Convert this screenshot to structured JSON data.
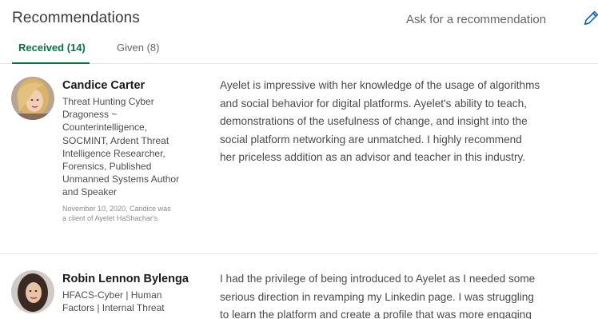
{
  "header": {
    "title": "Recommendations",
    "ask_link": "Ask for a recommendation",
    "edit_icon": "pencil-icon"
  },
  "tabs": [
    {
      "label": "Received (14)",
      "active": true
    },
    {
      "label": "Given (8)",
      "active": false
    }
  ],
  "recommendations": [
    {
      "name": "Candice Carter",
      "headline_lines": [
        "Threat Hunting Cyber",
        "Dragoness ~",
        "Counterintelligence,",
        "SOCMINT, Ardent Threat",
        "Intelligence Researcher,",
        "Forensics, Published",
        "Unmanned Systems Author",
        "and Speaker"
      ],
      "meta_lines": [
        "November 10, 2020, Candice was",
        "a client of Ayelet HaShachar's"
      ],
      "text_lines": [
        "Ayelet is impressive with her knowledge of the usage of algorithms",
        "and social behavior for digital platforms. Ayelet's ability to teach,",
        "demonstrations of the usefulness of change, and insight into the",
        "social platform networking are unmatched. I highly recommend",
        "her priceless addition as an advisor and teacher in this industry."
      ]
    },
    {
      "name": "Robin Lennon Bylenga",
      "headline_lines": [
        "HFACS-Cyber | Human",
        "Factors | Internal Threat"
      ],
      "text_lines": [
        "I had the privilege of being introduced to Ayelet as I needed some",
        "serious direction in revamping my Linkedin page. I was struggling",
        "to learn the platform and create a profile that was more engaging"
      ]
    }
  ],
  "colors": {
    "accent_green": "#057642",
    "text_gray": "#666666",
    "pencil_blue": "#0a66c2"
  }
}
